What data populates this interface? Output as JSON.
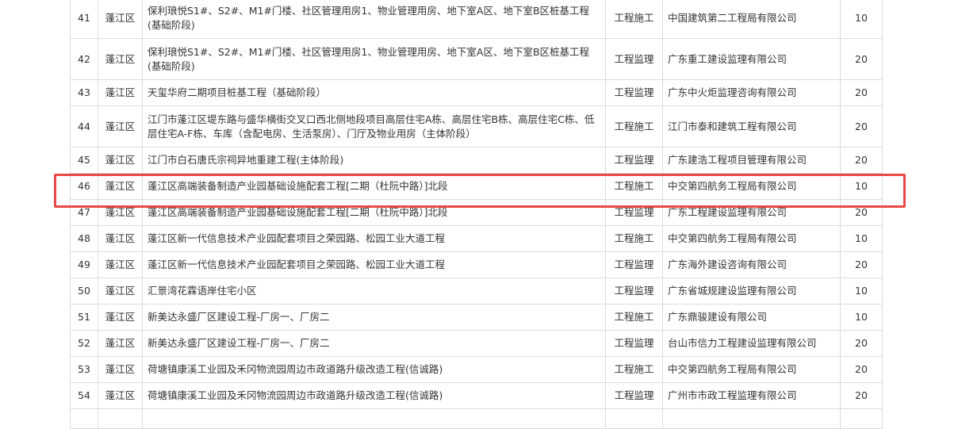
{
  "table": {
    "rows": [
      {
        "no": "41",
        "area": "蓬江区",
        "name": "保利琅悦S1#、S2#、M1#门楼、社区管理用房1、物业管理用房、地下室A区、地下室B区桩基工程(基础阶段)",
        "type": "工程施工",
        "unit": "中国建筑第二工程局有限公司",
        "score": "10"
      },
      {
        "no": "42",
        "area": "蓬江区",
        "name": "保利琅悦S1#、S2#、M1#门楼、社区管理用房1、物业管理用房、地下室A区、地下室B区桩基工程(基础阶段)",
        "type": "工程监理",
        "unit": "广东重工建设监理有限公司",
        "score": "20"
      },
      {
        "no": "43",
        "area": "蓬江区",
        "name": "天玺华府二期项目桩基工程（基础阶段）",
        "type": "工程监理",
        "unit": "广东中火炬监理咨询有限公司",
        "score": "20"
      },
      {
        "no": "44",
        "area": "蓬江区",
        "name": "江门市蓬江区堤东路与盛华横街交叉口西北侧地段项目高层住宅A栋、高层住宅B栋、高层住宅C栋、低层住宅A-F栋、车库（含配电房、生活泵房）、门厅及物业用房（主体阶段）",
        "type": "工程施工",
        "unit": "江门市泰和建筑工程有限公司",
        "score": "20"
      },
      {
        "no": "45",
        "area": "蓬江区",
        "name": "江门市白石唐氏宗祠异地重建工程(主体阶段)",
        "type": "工程监理",
        "unit": "广东建浩工程项目管理有限公司",
        "score": "20"
      },
      {
        "no": "46",
        "area": "蓬江区",
        "name": "蓬江区高端装备制造产业园基础设施配套工程[二期（杜阮中路）]北段",
        "type": "工程施工",
        "unit": "中交第四航务工程局有限公司",
        "score": "10"
      },
      {
        "no": "47",
        "area": "蓬江区",
        "name": "蓬江区高端装备制造产业园基础设施配套工程[二期（杜阮中路）]北段",
        "type": "工程监理",
        "unit": "广东工程建设监理有限公司",
        "score": "20"
      },
      {
        "no": "48",
        "area": "蓬江区",
        "name": "蓬江区新一代信息技术产业园配套项目之荣园路、松园工业大道工程",
        "type": "工程施工",
        "unit": "中交第四航务工程局有限公司",
        "score": "10"
      },
      {
        "no": "49",
        "area": "蓬江区",
        "name": "蓬江区新一代信息技术产业园配套项目之荣园路、松园工业大道工程",
        "type": "工程监理",
        "unit": "广东海外建设咨询有限公司",
        "score": "20"
      },
      {
        "no": "50",
        "area": "蓬江区",
        "name": "汇景湾花霖语岸住宅小区",
        "type": "工程监理",
        "unit": "广东省城规建设监理有限公司",
        "score": "10"
      },
      {
        "no": "51",
        "area": "蓬江区",
        "name": "新美达永盛厂区建设工程-厂房一、厂房二",
        "type": "工程施工",
        "unit": "广东鼎骏建设有限公司",
        "score": "10"
      },
      {
        "no": "52",
        "area": "蓬江区",
        "name": "新美达永盛厂区建设工程-厂房一、厂房二",
        "type": "工程监理",
        "unit": "台山市信力工程建设监理有限公司",
        "score": "20"
      },
      {
        "no": "53",
        "area": "蓬江区",
        "name": "荷塘镇康溪工业园及禾冈物流园周边市政道路升级改造工程(信诚路)",
        "type": "工程施工",
        "unit": "中交第四航务工程局有限公司",
        "score": "20"
      },
      {
        "no": "54",
        "area": "蓬江区",
        "name": "荷塘镇康溪工业园及禾冈物流园周边市政道路升级改造工程(信诚路)",
        "type": "工程监理",
        "unit": "广州市市政工程监理有限公司",
        "score": "20"
      }
    ]
  },
  "highlight": {
    "row_no": "46",
    "color": "#e84848"
  }
}
